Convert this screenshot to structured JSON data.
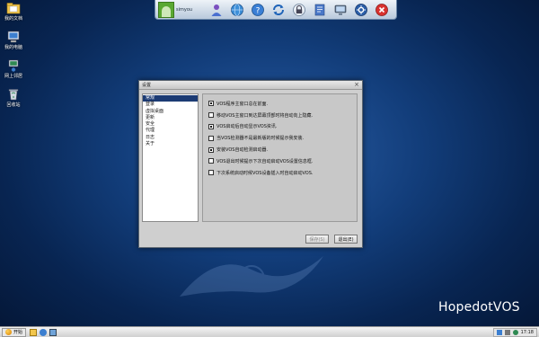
{
  "desktop": {
    "icons": [
      {
        "label": "我的文档",
        "icon": "folder-documents-icon"
      },
      {
        "label": "我的电脑",
        "icon": "computer-icon"
      },
      {
        "label": "网上邻居",
        "icon": "network-icon"
      },
      {
        "label": "回收站",
        "icon": "recycle-bin-icon"
      }
    ],
    "brand": "HopedotVOS"
  },
  "dock": {
    "username": "simyou",
    "buttons": [
      "user-icon",
      "globe-icon",
      "help-icon",
      "refresh-icon",
      "lock-icon",
      "notes-icon",
      "monitor-icon",
      "settings-icon",
      "close-icon"
    ]
  },
  "dialog": {
    "title": "设置",
    "close": "×",
    "nav": [
      "常规",
      "登录",
      "虚拟桌面",
      "更新",
      "安全",
      "代理",
      "日志",
      "关于"
    ],
    "selected_nav": "常规",
    "options": [
      {
        "label": "VOS程序主窗口总在前面.",
        "checked": true
      },
      {
        "label": "移动VOS主窗口到达屏幕顶部时将自动向上隐藏.",
        "checked": false
      },
      {
        "label": "VOS启动后自动显示VOS资讯.",
        "checked": true
      },
      {
        "label": "当VOS检测器不是最新版的时候提示我安装.",
        "checked": false
      },
      {
        "label": "安装VOS自动检测启动器.",
        "checked": true
      },
      {
        "label": "VOS退出时候提示下次自动启动VOS设置信息框.",
        "checked": false
      },
      {
        "label": "下次系统启动时候VOS设备插入时自动启动VOS.",
        "checked": false
      }
    ],
    "buttons": {
      "save": "保存(S)",
      "exit": "退出(E)"
    }
  },
  "taskbar": {
    "start_label": "开始",
    "clock": "17:18"
  },
  "colors": {
    "nav_active": "#1c3b74",
    "desktop_bg": "#123d7a"
  }
}
